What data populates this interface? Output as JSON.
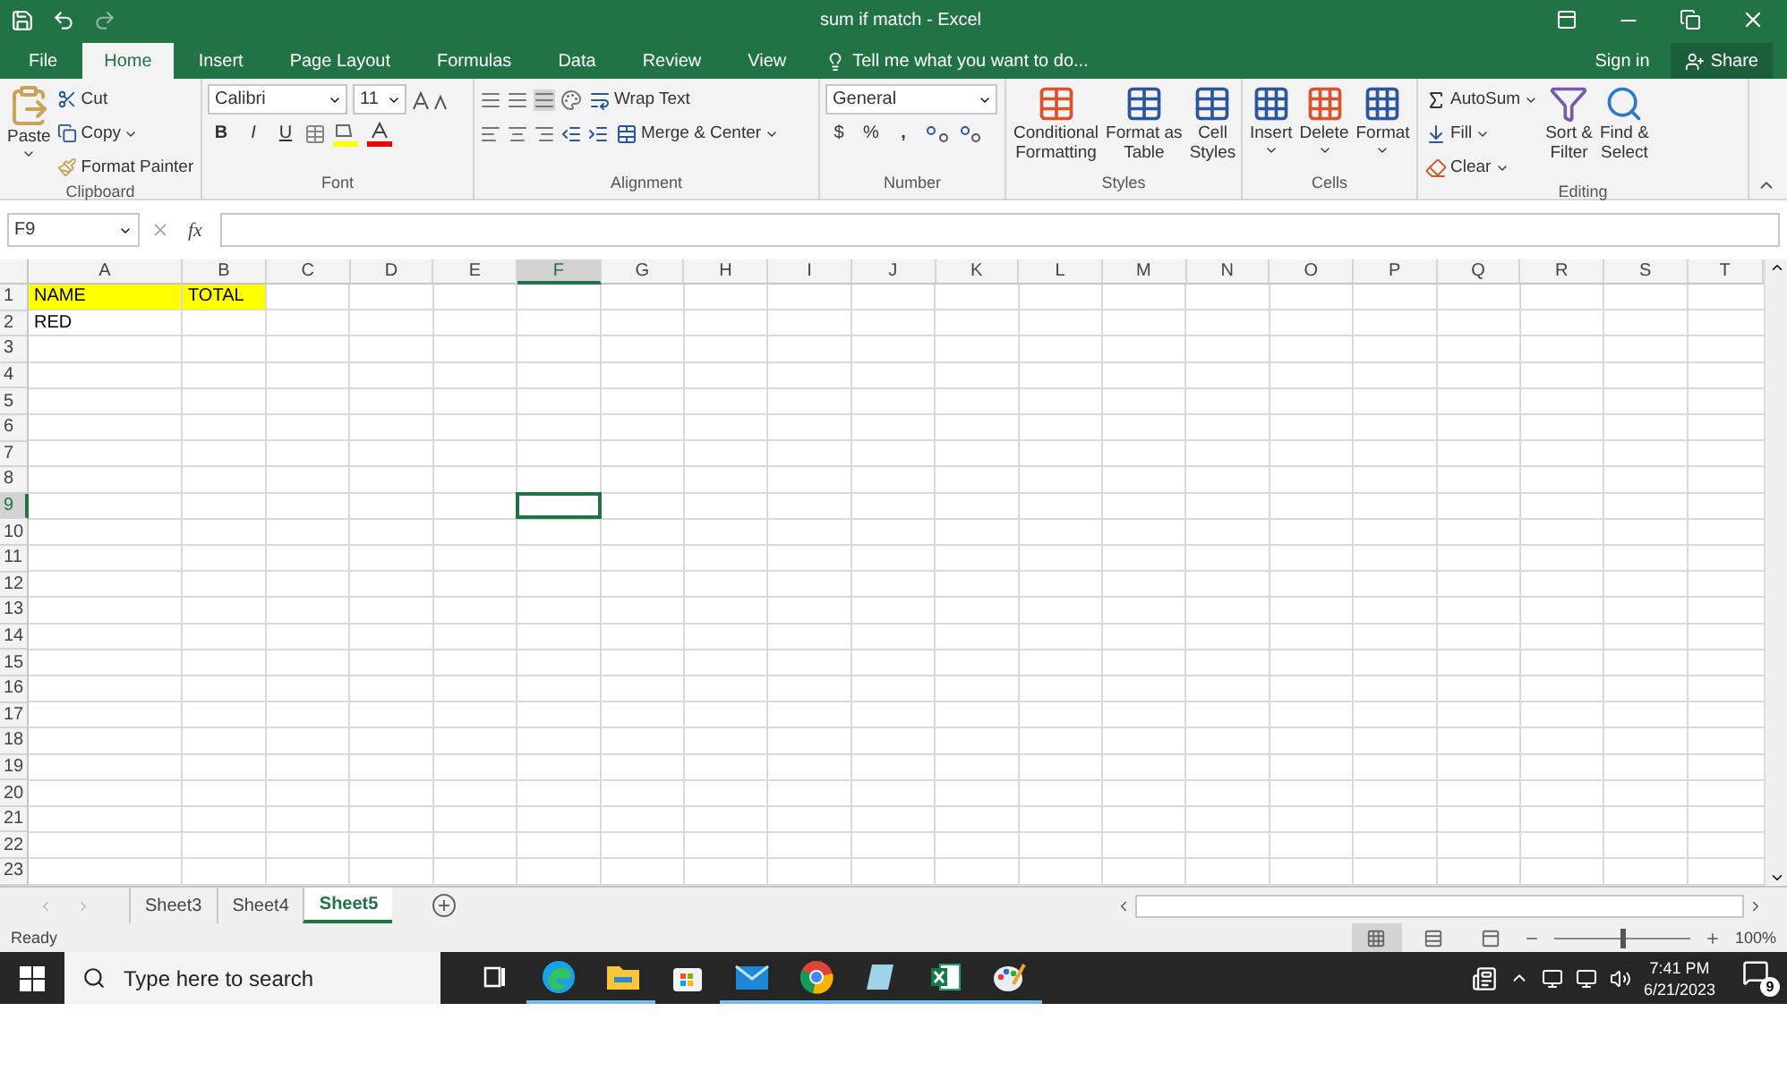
{
  "window": {
    "title": "sum if match - Excel"
  },
  "ribbon_tabs": [
    {
      "label": "File",
      "selected": false
    },
    {
      "label": "Home",
      "selected": true
    },
    {
      "label": "Insert",
      "selected": false
    },
    {
      "label": "Page Layout",
      "selected": false
    },
    {
      "label": "Formulas",
      "selected": false
    },
    {
      "label": "Data",
      "selected": false
    },
    {
      "label": "Review",
      "selected": false
    },
    {
      "label": "View",
      "selected": false
    }
  ],
  "tell_me": "Tell me what you want to do...",
  "account": {
    "sign_in": "Sign in",
    "share": "Share"
  },
  "clipboard": {
    "label": "Clipboard",
    "paste": "Paste",
    "cut": "Cut",
    "copy": "Copy",
    "format_painter": "Format Painter"
  },
  "font": {
    "label": "Font",
    "font_name": "Calibri",
    "font_size": "11",
    "bold": "B",
    "italic": "I",
    "underline": "U"
  },
  "alignment": {
    "label": "Alignment",
    "wrap_text": "Wrap Text",
    "merge_center": "Merge & Center"
  },
  "number": {
    "label": "Number",
    "format": "General",
    "currency": "$",
    "percent": "%",
    "comma": ","
  },
  "styles": {
    "label": "Styles",
    "buttons": [
      {
        "line1": "Conditional",
        "line2": "Formatting"
      },
      {
        "line1": "Format as",
        "line2": "Table"
      },
      {
        "line1": "Cell",
        "line2": "Styles"
      }
    ]
  },
  "cells": {
    "label": "Cells",
    "buttons": [
      "Insert",
      "Delete",
      "Format"
    ]
  },
  "editing": {
    "label": "Editing",
    "autosum": "AutoSum",
    "fill": "Fill",
    "clear": "Clear",
    "sort_filter": {
      "line1": "Sort &",
      "line2": "Filter"
    },
    "find_select": {
      "line1": "Find &",
      "line2": "Select"
    }
  },
  "formula_bar": {
    "name_box": "F9",
    "function_label": "fx"
  },
  "columns": [
    {
      "label": "A",
      "selected": false
    },
    {
      "label": "B",
      "selected": false
    },
    {
      "label": "C",
      "selected": false
    },
    {
      "label": "D",
      "selected": false
    },
    {
      "label": "E",
      "selected": false
    },
    {
      "label": "F",
      "selected": true
    },
    {
      "label": "G",
      "selected": false
    },
    {
      "label": "H",
      "selected": false
    },
    {
      "label": "I",
      "selected": false
    },
    {
      "label": "J",
      "selected": false
    },
    {
      "label": "K",
      "selected": false
    },
    {
      "label": "L",
      "selected": false
    },
    {
      "label": "M",
      "selected": false
    },
    {
      "label": "N",
      "selected": false
    },
    {
      "label": "O",
      "selected": false
    },
    {
      "label": "P",
      "selected": false
    },
    {
      "label": "Q",
      "selected": false
    },
    {
      "label": "R",
      "selected": false
    },
    {
      "label": "S",
      "selected": false
    },
    {
      "label": "T",
      "selected": false
    }
  ],
  "rows": [
    {
      "label": "1",
      "selected": false,
      "cells": [
        {
          "text": "NAME",
          "color": "#ffff00"
        },
        {
          "text": "TOTAL",
          "color": "#ffff00"
        }
      ]
    },
    {
      "label": "2",
      "selected": false,
      "cells": [
        {
          "text": "RED"
        }
      ]
    },
    {
      "label": "3",
      "selected": false
    },
    {
      "label": "4",
      "selected": false
    },
    {
      "label": "5",
      "selected": false
    },
    {
      "label": "6",
      "selected": false
    },
    {
      "label": "7",
      "selected": false
    },
    {
      "label": "8",
      "selected": false
    },
    {
      "label": "9",
      "selected": true
    },
    {
      "label": "10",
      "selected": false
    },
    {
      "label": "11",
      "selected": false
    },
    {
      "label": "12",
      "selected": false
    },
    {
      "label": "13",
      "selected": false
    },
    {
      "label": "14",
      "selected": false
    },
    {
      "label": "15",
      "selected": false
    },
    {
      "label": "16",
      "selected": false
    },
    {
      "label": "17",
      "selected": false
    },
    {
      "label": "18",
      "selected": false
    },
    {
      "label": "19",
      "selected": false
    },
    {
      "label": "20",
      "selected": false
    },
    {
      "label": "21",
      "selected": false
    },
    {
      "label": "22",
      "selected": false
    },
    {
      "label": "23",
      "selected": false
    }
  ],
  "sheet_tabs": [
    {
      "label": "Sheet3",
      "selected": false
    },
    {
      "label": "Sheet4",
      "selected": false
    },
    {
      "label": "Sheet5",
      "selected": true
    }
  ],
  "status_bar": {
    "status": "Ready",
    "zoom": "100%",
    "zoom_level": {
      "level": 0.5
    },
    "views": [
      {
        "kind": "normal",
        "selected": true
      },
      {
        "kind": "layout",
        "selected": false
      },
      {
        "kind": "break",
        "selected": false
      }
    ]
  },
  "taskbar": {
    "search_placeholder": "Type here to search",
    "time": "7:41 PM",
    "date": "6/21/2023",
    "notifications": "9",
    "apps": [
      {
        "kind": "taskview",
        "open": false
      },
      {
        "kind": "edge",
        "open": true
      },
      {
        "kind": "explorer",
        "open": true
      },
      {
        "kind": "store",
        "open": false
      },
      {
        "kind": "mail",
        "open": true
      },
      {
        "kind": "chrome",
        "open": true
      },
      {
        "kind": "notes",
        "open": true
      },
      {
        "kind": "excel",
        "open": true
      },
      {
        "kind": "paint",
        "open": true
      }
    ]
  }
}
